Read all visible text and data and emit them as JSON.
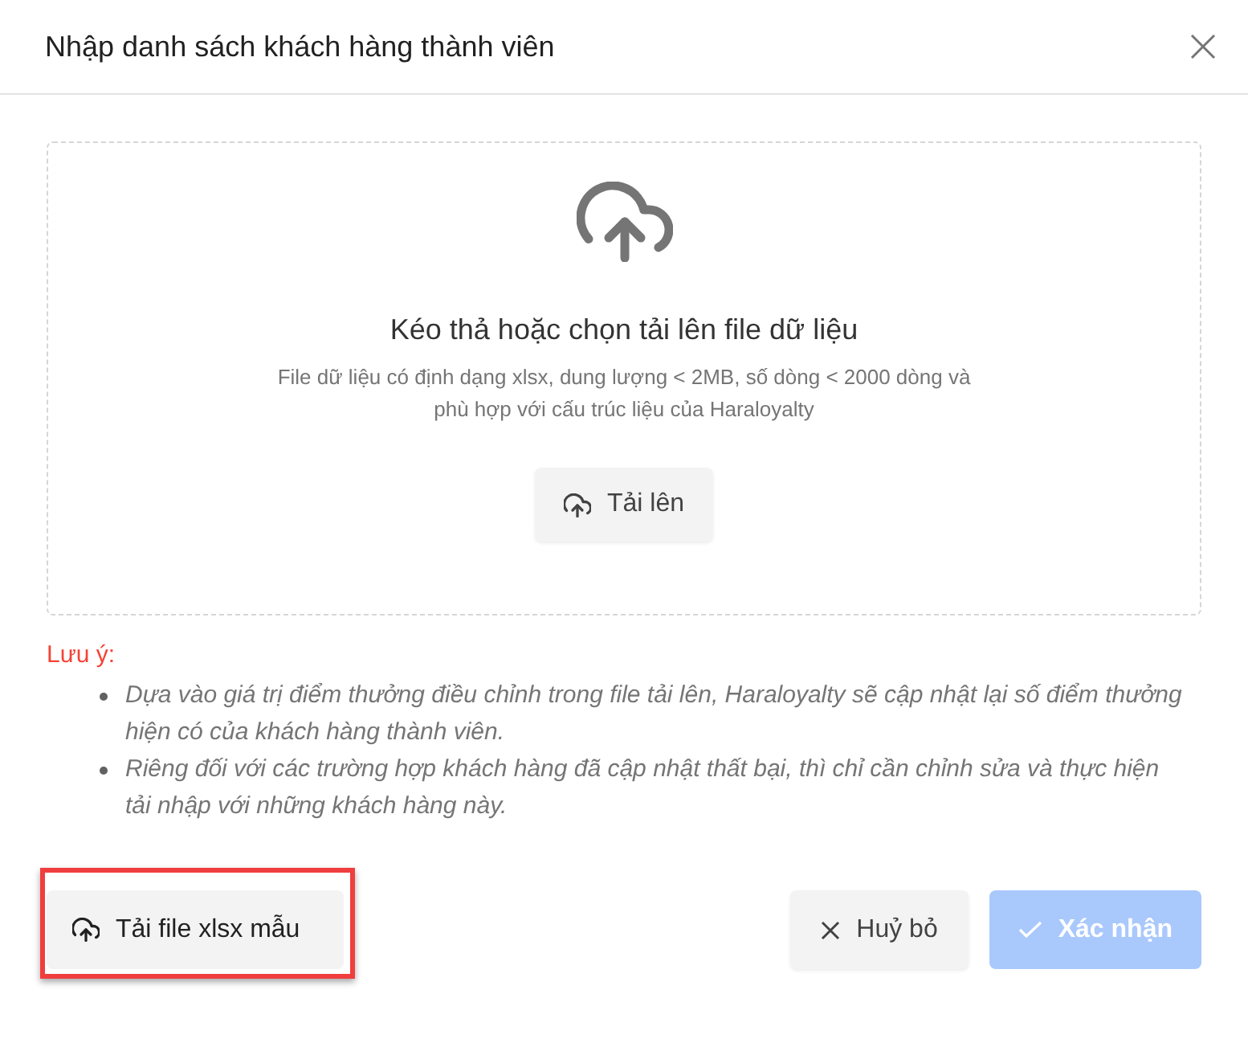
{
  "dialog": {
    "title": "Nhập danh sách khách hàng thành viên"
  },
  "dropzone": {
    "heading": "Kéo thả hoặc chọn tải lên file dữ liệu",
    "description": "File dữ liệu có định dạng xlsx, dung lượng < 2MB, số dòng < 2000 dòng và phù hợp với cấu trúc liệu của Haraloyalty",
    "upload_button": {
      "label": "Tải lên"
    }
  },
  "note": {
    "label": "Lưu ý:",
    "items": [
      "Dựa vào giá trị điểm thưởng điều chỉnh trong file tải lên, Haraloyalty sẽ cập nhật lại số điểm thưởng hiện có của khách hàng thành viên.",
      "Riêng đối với các trường hợp khách hàng đã cập nhật thất bại, thì chỉ cần chỉnh sửa và thực hiện tải nhập với những khách hàng này."
    ]
  },
  "footer": {
    "template_button": {
      "label": "Tải file xlsx mẫu",
      "highlighted": true
    },
    "buttons": [
      {
        "kind": "cancel",
        "label": "Huỷ bỏ",
        "disabled": false
      },
      {
        "kind": "confirm",
        "label": "Xác nhận",
        "disabled": true
      }
    ]
  }
}
